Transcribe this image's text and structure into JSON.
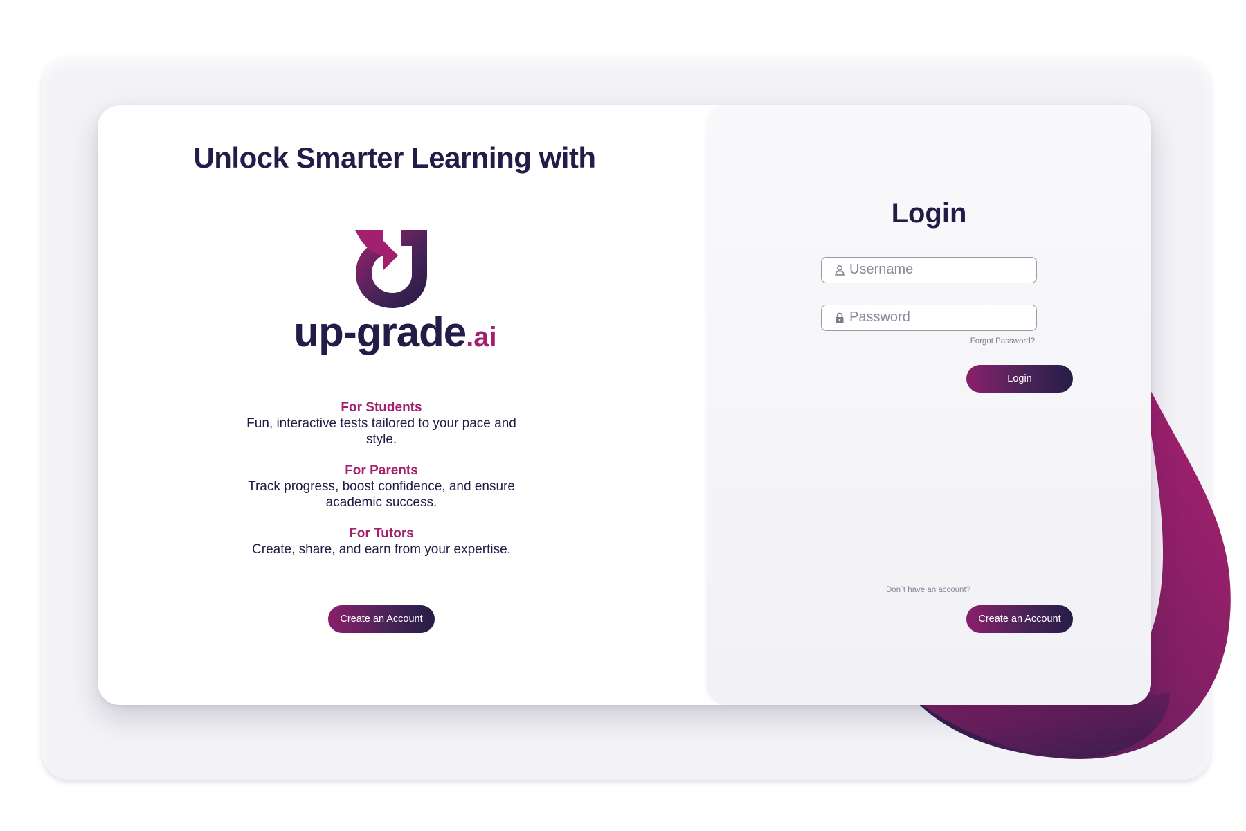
{
  "left": {
    "headline": "Unlock Smarter Learning with",
    "logo": {
      "wordmark": "up-grade",
      "suffix": ".ai"
    },
    "features": [
      {
        "title": "For Students",
        "text": "Fun, interactive tests tailored to your pace and style."
      },
      {
        "title": "For Parents",
        "text": "Track progress, boost confidence, and ensure academic success."
      },
      {
        "title": "For Tutors",
        "text": "Create, share, and earn from your expertise."
      }
    ],
    "create_account_label": "Create an Account"
  },
  "login": {
    "title": "Login",
    "username_placeholder": "Username",
    "password_placeholder": "Password",
    "forgot_label": "Forgot Password?",
    "submit_label": "Login",
    "no_account_text": "Don´t have an account?",
    "create_account_label": "Create an Account"
  },
  "colors": {
    "navy": "#221c47",
    "magenta": "#a3206e",
    "panel_bg": "#f3f2f6"
  },
  "icons": {
    "username": "user-icon",
    "password": "lock-icon",
    "logo": "upgrade-logo-mark"
  }
}
